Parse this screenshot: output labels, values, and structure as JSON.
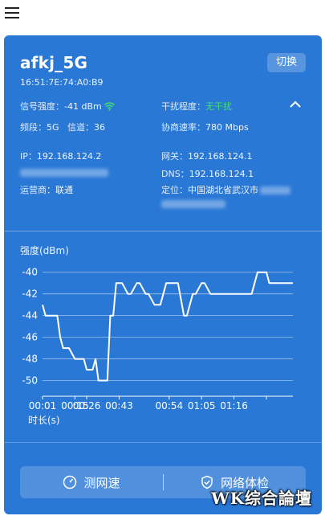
{
  "menu": {
    "icon": "hamburger-icon"
  },
  "network": {
    "ssid": "afkj_5G",
    "bssid": "16:51:7E:74:A0:B9",
    "switch_label": "切换",
    "signal_label": "信号强度：",
    "signal_value": "-41 dBm",
    "interference_label": "干扰程度：",
    "interference_value": "无干扰",
    "band_label": "频段：",
    "band_value": "5G",
    "channel_label": "信道：",
    "channel_value": "36",
    "rate_label": "协商速率：",
    "rate_value": "780 Mbps",
    "ip_label": "IP：",
    "ip_value": "192.168.124.2",
    "gateway_label": "网关：",
    "gateway_value": "192.168.124.1",
    "dns_label": "DNS：",
    "dns_value": "192.168.124.1",
    "isp_label": "运营商：",
    "isp_value": "联通",
    "location_label": "定位：",
    "location_value": "中国湖北省武汉市"
  },
  "chart_title": "强度(dBm)",
  "chart_xlabel": "时长(s)",
  "chart_data": {
    "type": "line",
    "title": "",
    "ylabel": "强度(dBm)",
    "xlabel": "时长(s)",
    "ylim": [
      -51,
      -39.5
    ],
    "xlim": [
      0,
      85
    ],
    "yticks": [
      -40,
      -42,
      -44,
      -46,
      -48,
      -50
    ],
    "xtick_values": [
      0,
      11,
      15,
      26,
      43,
      54,
      65,
      76
    ],
    "xtick_labels": [
      "00:01",
      "00:15",
      "00:26",
      "00:43",
      "00:54",
      "01:05",
      "01:16",
      ""
    ],
    "x": [
      0,
      1,
      2,
      5,
      6,
      7,
      9,
      11,
      12,
      14,
      15,
      17,
      18,
      19,
      20,
      22,
      23,
      24,
      25,
      26,
      27,
      29,
      30,
      32,
      33,
      35,
      36,
      38,
      39,
      40,
      42,
      43,
      45,
      46,
      48,
      49,
      51,
      52,
      54,
      55,
      57,
      58,
      60,
      61,
      64,
      65,
      70,
      71,
      73,
      74,
      76,
      77,
      79,
      80,
      82,
      83,
      85
    ],
    "y": [
      -43,
      -44,
      -44,
      -44,
      -46,
      -47,
      -47,
      -48,
      -48,
      -48,
      -49,
      -49,
      -48,
      -50,
      -50,
      -50,
      -44,
      -44,
      -41,
      -41,
      -41,
      -42,
      -42,
      -41,
      -41,
      -42,
      -42,
      -43,
      -43,
      -43,
      -41,
      -41,
      -41,
      -41,
      -44,
      -44,
      -42,
      -42,
      -41,
      -41,
      -42,
      -42,
      -42,
      -42,
      -42,
      -42,
      -42,
      -42,
      -40,
      -40,
      -40,
      -41,
      -41,
      -41,
      -41,
      -41,
      -41
    ],
    "grid": "horizontal",
    "line_color": "#ffffff"
  },
  "actions": {
    "speed_test": "测网速",
    "network_check": "网络体检"
  },
  "watermark": "WK综合論壇",
  "colors": {
    "card_bg": "#2a78d6",
    "accent_green": "#43e26a"
  }
}
